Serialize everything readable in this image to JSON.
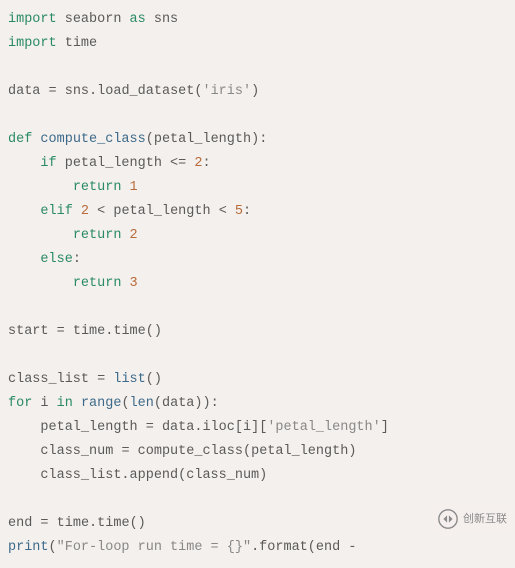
{
  "code": {
    "l1": {
      "kw1": "import",
      "sp1": " ",
      "id1": "seaborn",
      "sp2": " ",
      "kw2": "as",
      "sp3": " ",
      "id2": "sns"
    },
    "l2": {
      "kw1": "import",
      "sp1": " ",
      "id1": "time"
    },
    "l3": "",
    "l4": {
      "id1": "data",
      "sp1": " ",
      "op1": "=",
      "sp2": " ",
      "id2": "sns",
      "op2": ".",
      "fn1": "load_dataset",
      "op3": "(",
      "str1": "'iris'",
      "op4": ")"
    },
    "l5": "",
    "l6": {
      "kw1": "def",
      "sp1": " ",
      "fn1": "compute_class",
      "op1": "(",
      "id1": "petal_length",
      "op2": ")",
      "op3": ":"
    },
    "l7": {
      "ind": "    ",
      "kw1": "if",
      "sp1": " ",
      "id1": "petal_length",
      "sp2": " ",
      "op1": "<=",
      "sp3": " ",
      "num1": "2",
      "op2": ":"
    },
    "l8": {
      "ind": "        ",
      "kw1": "return",
      "sp1": " ",
      "num1": "1"
    },
    "l9": {
      "ind": "    ",
      "kw1": "elif",
      "sp1": " ",
      "num1": "2",
      "sp2": " ",
      "op1": "<",
      "sp3": " ",
      "id1": "petal_length",
      "sp4": " ",
      "op2": "<",
      "sp5": " ",
      "num2": "5",
      "op3": ":"
    },
    "l10": {
      "ind": "        ",
      "kw1": "return",
      "sp1": " ",
      "num1": "2"
    },
    "l11": {
      "ind": "    ",
      "kw1": "else",
      "op1": ":"
    },
    "l12": {
      "ind": "        ",
      "kw1": "return",
      "sp1": " ",
      "num1": "3"
    },
    "l13": "",
    "l14": {
      "id1": "start",
      "sp1": " ",
      "op1": "=",
      "sp2": " ",
      "id2": "time",
      "op2": ".",
      "fn1": "time",
      "op3": "(",
      ")": ""
    },
    "l14b": {
      "close": ")"
    },
    "l15": "",
    "l16": {
      "id1": "class_list",
      "sp1": " ",
      "op1": "=",
      "sp2": " ",
      "fn1": "list",
      "op2": "(",
      "op3": ")"
    },
    "l17": {
      "kw1": "for",
      "sp1": " ",
      "id1": "i",
      "sp2": " ",
      "kw2": "in",
      "sp3": " ",
      "fn1": "range",
      "op1": "(",
      "fn2": "len",
      "op2": "(",
      "id2": "data",
      "op3": ")",
      "op4": ")",
      "op5": ":"
    },
    "l18": {
      "ind": "    ",
      "id1": "petal_length",
      "sp1": " ",
      "op1": "=",
      "sp2": " ",
      "id2": "data",
      "op2": ".",
      "fn1": "iloc",
      "op3": "[",
      "id3": "i",
      "op4": "]",
      "op5": "[",
      "str1": "'petal_length'",
      "op6": "]"
    },
    "l19": {
      "ind": "    ",
      "id1": "class_num",
      "sp1": " ",
      "op1": "=",
      "sp2": " ",
      "fn1": "compute_class",
      "op2": "(",
      "id2": "petal_length",
      "op3": ")"
    },
    "l20": {
      "ind": "    ",
      "id1": "class_list",
      "op1": ".",
      "fn1": "append",
      "op2": "(",
      "id2": "class_num",
      "op3": ")"
    },
    "l21": "",
    "l22": {
      "id1": "end",
      "sp1": " ",
      "op1": "=",
      "sp2": " ",
      "id2": "time",
      "op2": ".",
      "fn1": "time",
      "op3": "(",
      "op4": ")"
    },
    "l23": {
      "fn1": "print",
      "op1": "(",
      "str1": "\"For-loop run time = {}\"",
      "op2": ".",
      "fn2": "format",
      "op3": "(",
      "id1": "end",
      "sp1": " ",
      "op4": "-",
      "sp2": " "
    }
  },
  "watermark": {
    "text": "创新互联"
  }
}
